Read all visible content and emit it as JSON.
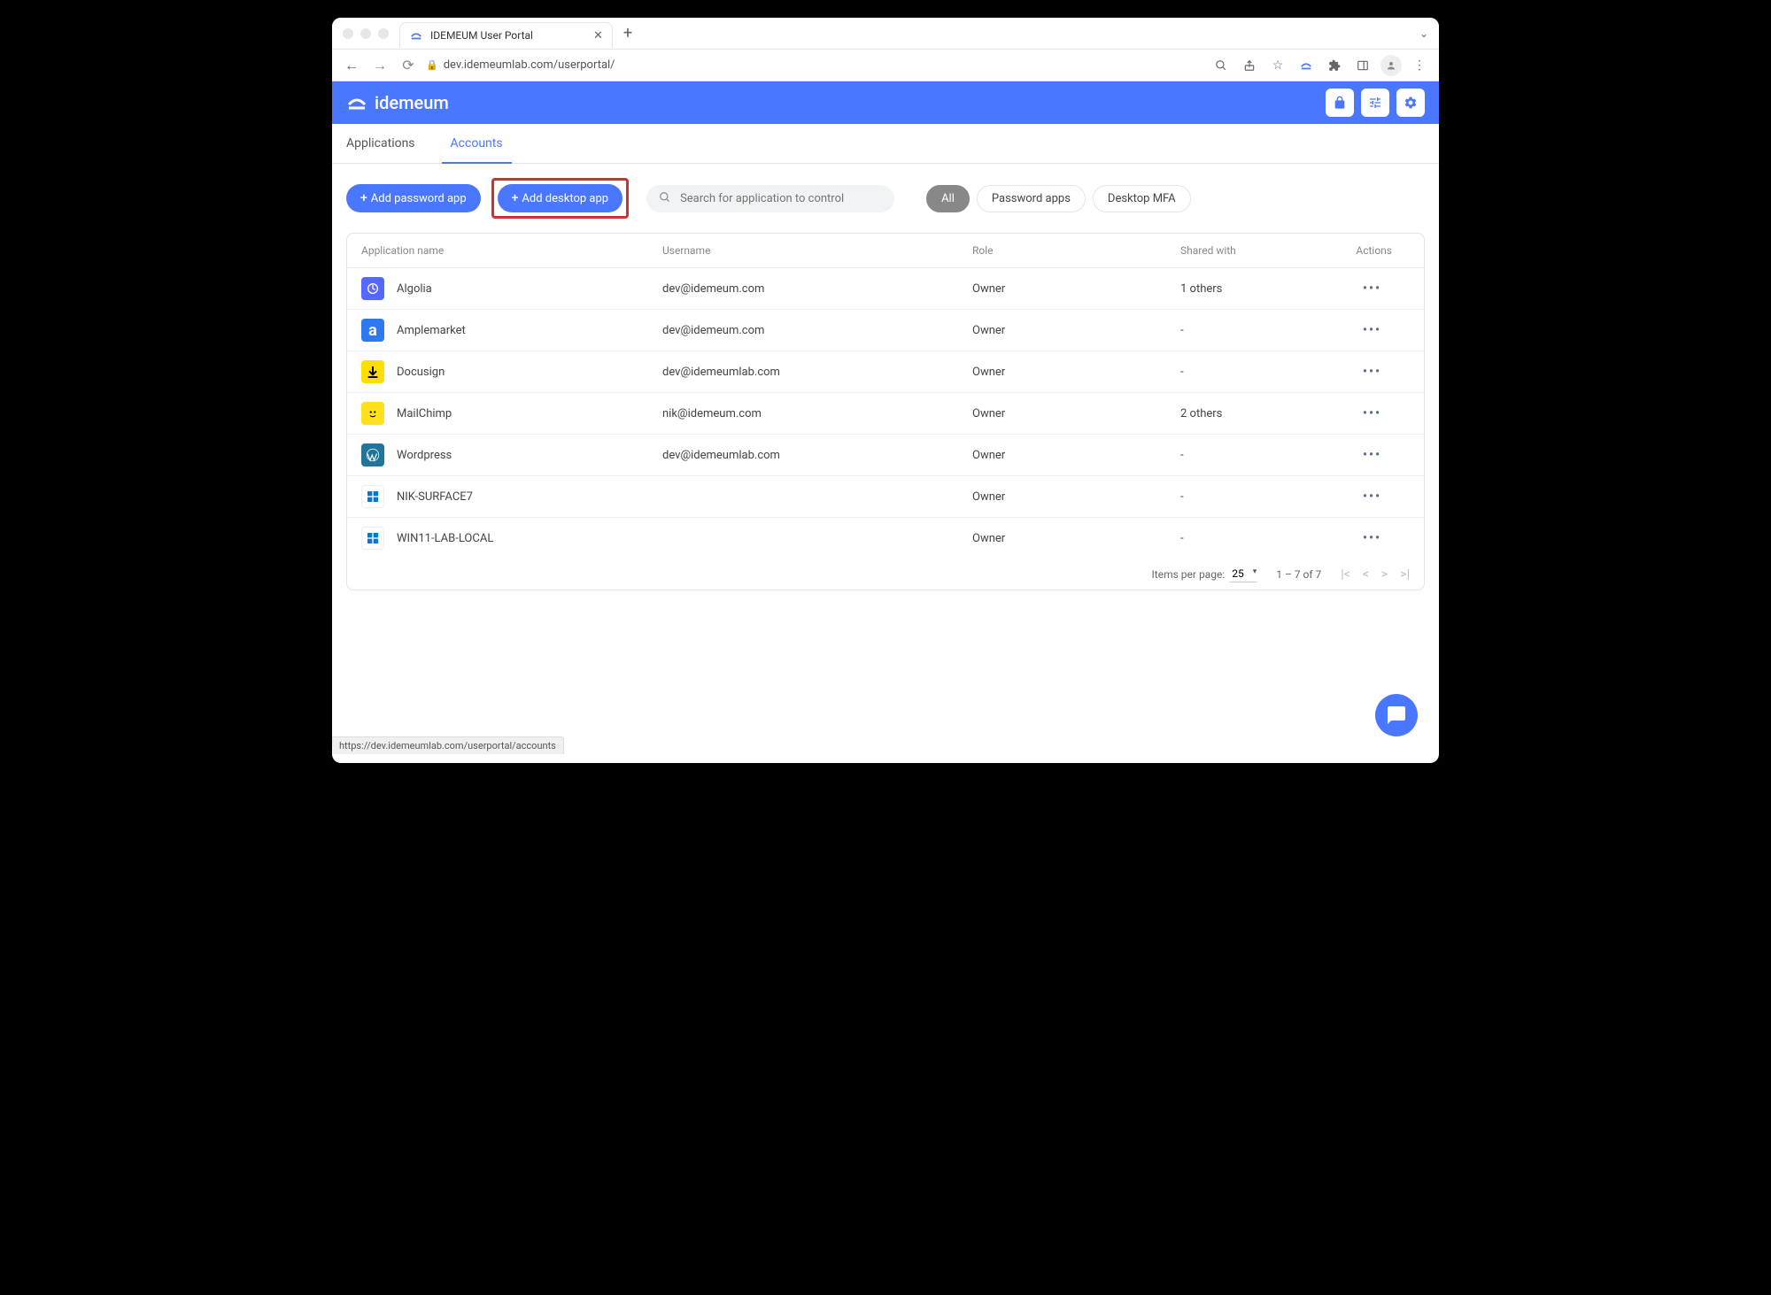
{
  "browser": {
    "tab_title": "IDEMEUM User Portal",
    "url": "dev.idemeumlab.com/userportal/",
    "status_url": "https://dev.idemeumlab.com/userportal/accounts"
  },
  "header": {
    "brand": "idemeum"
  },
  "nav_tabs": {
    "applications": "Applications",
    "accounts": "Accounts"
  },
  "toolbar": {
    "add_password_label": "Add password app",
    "add_desktop_label": "Add desktop app",
    "search_placeholder": "Search for application to control"
  },
  "filters": {
    "all": "All",
    "password_apps": "Password apps",
    "desktop_mfa": "Desktop MFA"
  },
  "table": {
    "headers": {
      "app": "Application name",
      "user": "Username",
      "role": "Role",
      "shared": "Shared with",
      "actions": "Actions"
    },
    "rows": [
      {
        "app": "Algolia",
        "user": "dev@idemeum.com",
        "role": "Owner",
        "shared": "1 others",
        "icon_class": "algolia",
        "icon_name": "algolia-icon"
      },
      {
        "app": "Amplemarket",
        "user": "dev@idemeum.com",
        "role": "Owner",
        "shared": "-",
        "icon_class": "amplemarket",
        "icon_name": "amplemarket-icon"
      },
      {
        "app": "Docusign",
        "user": "dev@idemeumlab.com",
        "role": "Owner",
        "shared": "-",
        "icon_class": "docusign",
        "icon_name": "docusign-icon"
      },
      {
        "app": "MailChimp",
        "user": "nik@idemeum.com",
        "role": "Owner",
        "shared": "2 others",
        "icon_class": "mailchimp",
        "icon_name": "mailchimp-icon"
      },
      {
        "app": "Wordpress",
        "user": "dev@idemeumlab.com",
        "role": "Owner",
        "shared": "-",
        "icon_class": "wordpress",
        "icon_name": "wordpress-icon"
      },
      {
        "app": "NIK-SURFACE7",
        "user": "",
        "role": "Owner",
        "shared": "-",
        "icon_class": "windows",
        "icon_name": "windows-icon"
      },
      {
        "app": "WIN11-LAB-LOCAL",
        "user": "",
        "role": "Owner",
        "shared": "-",
        "icon_class": "windows",
        "icon_name": "windows-icon"
      }
    ]
  },
  "paginator": {
    "items_label": "Items per page:",
    "page_size": "25",
    "range": "1 – 7 of 7"
  }
}
